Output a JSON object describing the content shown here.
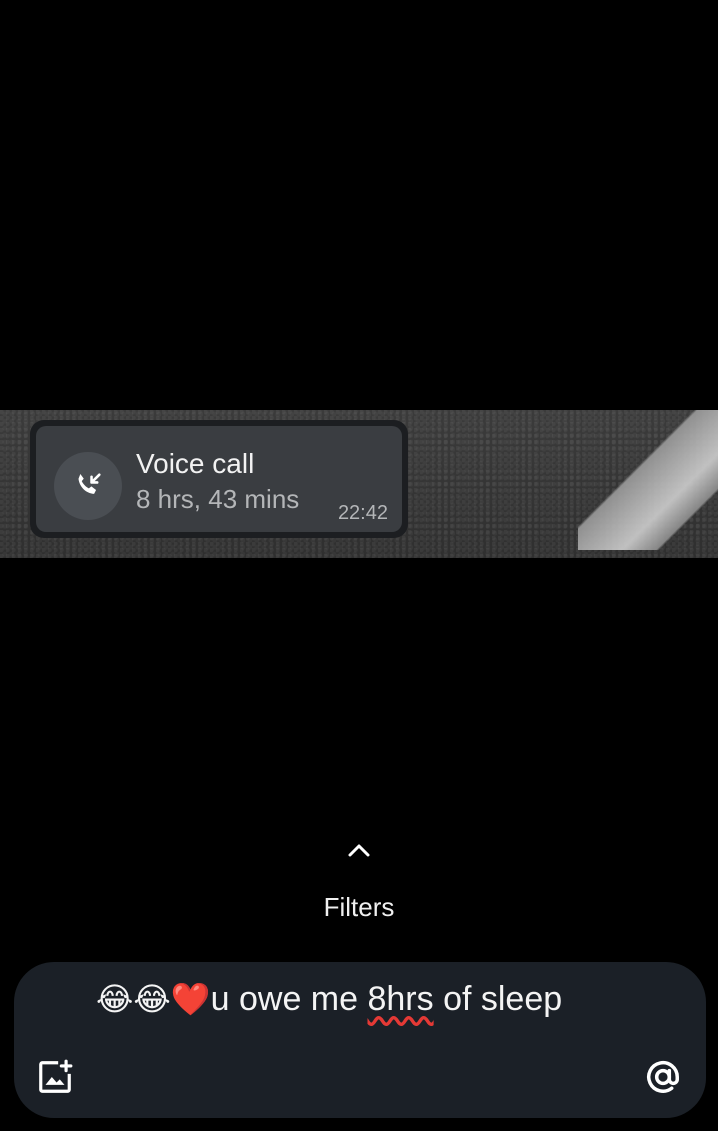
{
  "call_card": {
    "title": "Voice call",
    "duration": "8 hrs, 43 mins",
    "time": "22:42",
    "icon": "incoming-call-icon"
  },
  "filters": {
    "label": "Filters",
    "icon": "chevron-up-icon"
  },
  "composer": {
    "emoji": "😂😂❤️",
    "text_before": "u owe me ",
    "text_flagged": "8hrs",
    "text_after": " of sleep",
    "media_icon": "add-image-icon",
    "mention_icon": "at-sign-icon"
  },
  "colors": {
    "background": "#000000",
    "card": "#3a3d41",
    "composer": "#1b2027",
    "spellcheck": "#e53935"
  }
}
